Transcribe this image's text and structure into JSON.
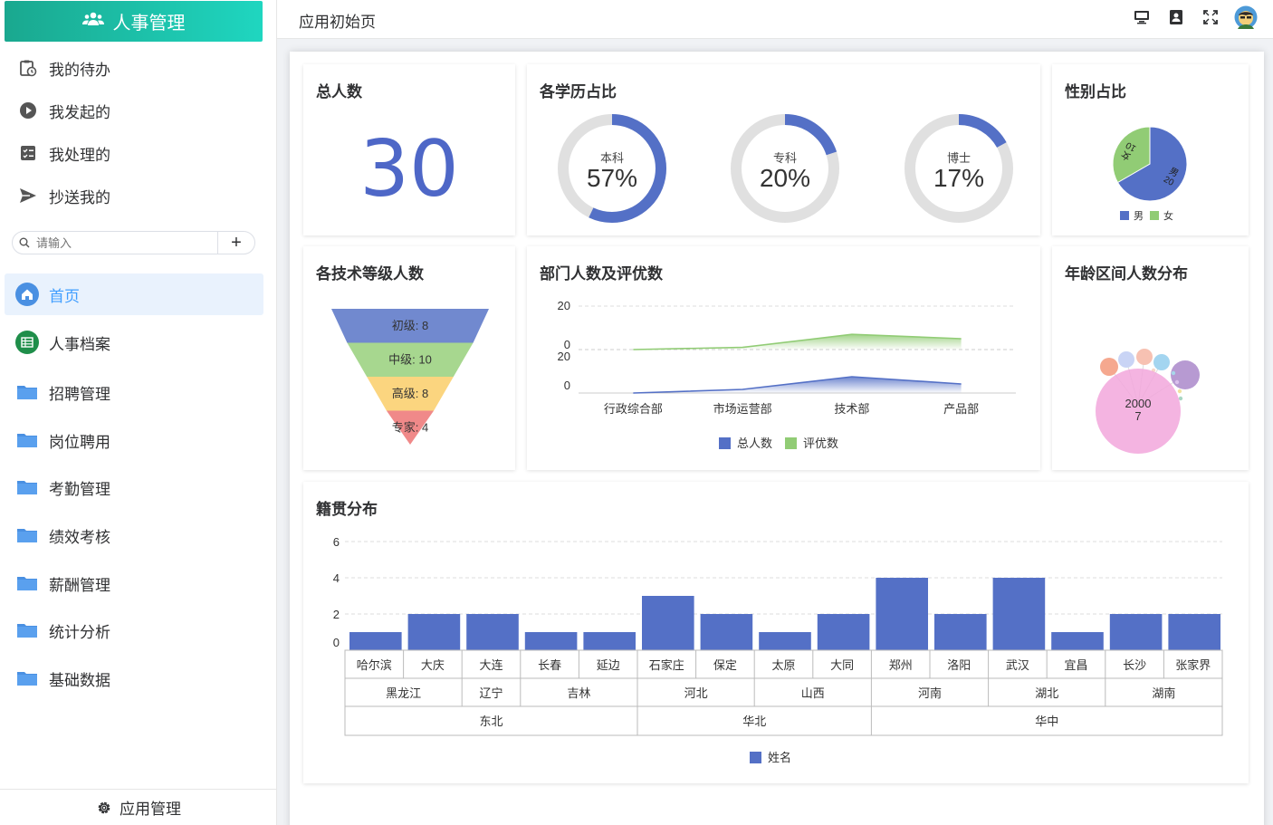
{
  "app": {
    "brand_title": "人事管理",
    "page_title": "应用初始页",
    "footer_label": "应用管理"
  },
  "sidebar": {
    "quick": [
      "我的待办",
      "我发起的",
      "我处理的",
      "抄送我的"
    ],
    "search_placeholder": "请输入",
    "home_label": "首页",
    "menu": [
      "人事档案",
      "招聘管理",
      "岗位聘用",
      "考勤管理",
      "绩效考核",
      "薪酬管理",
      "统计分析",
      "基础数据"
    ]
  },
  "colors": {
    "accent": "#5470c6",
    "green": "#91cc75",
    "yellow": "#fac858",
    "red": "#ee6666",
    "teal": "#1fc7b0"
  },
  "cards": {
    "total": {
      "title": "总人数",
      "value": "30"
    },
    "education": {
      "title": "各学历占比",
      "items": [
        {
          "label": "本科",
          "text": "57%",
          "value": 57
        },
        {
          "label": "专科",
          "text": "20%",
          "value": 20
        },
        {
          "label": "博士",
          "text": "17%",
          "value": 17
        }
      ]
    },
    "gender": {
      "title": "性别占比",
      "legend": [
        "男",
        "女"
      ]
    },
    "tech": {
      "title": "各技术等级人数"
    },
    "dept": {
      "title": "部门人数及评优数"
    },
    "age": {
      "title": "年龄区间人数分布"
    },
    "origin": {
      "title": "籍贯分布"
    }
  },
  "chart_data": [
    {
      "type": "pie",
      "title": "性别占比",
      "slices": [
        {
          "name": "男",
          "value": 20,
          "label_name": "男",
          "label_value": "20",
          "color": "#5470c6"
        },
        {
          "name": "女",
          "value": 10,
          "label_name": "女",
          "label_value": "10",
          "color": "#91cc75"
        }
      ],
      "legend": "bottom"
    },
    {
      "type": "funnel",
      "title": "各技术等级人数",
      "items": [
        {
          "name": "初级",
          "value": 8,
          "label": "初级: 8",
          "color": "#7189cf"
        },
        {
          "name": "中级",
          "value": 10,
          "label": "中级: 10",
          "color": "#a7d78f"
        },
        {
          "name": "高级",
          "value": 8,
          "label": "高级: 8",
          "color": "#fbd57f"
        },
        {
          "name": "专家",
          "value": 4,
          "label": "专家: 4",
          "color": "#f08989"
        }
      ]
    },
    {
      "type": "area",
      "title": "部门人数及评优数",
      "categories": [
        "行政综合部",
        "市场运营部",
        "技术部",
        "产品部"
      ],
      "series": [
        {
          "name": "总人数",
          "values": [
            0,
            2,
            9,
            5
          ],
          "color": "#5470c6"
        },
        {
          "name": "评优数",
          "values": [
            0,
            1,
            7,
            5
          ],
          "color": "#91cc75"
        }
      ],
      "ylim_top": [
        0,
        20
      ],
      "ylim_bottom": [
        0,
        20
      ],
      "y_ticks_top": [
        "20",
        "0"
      ],
      "y_ticks_bottom": [
        "20",
        "0"
      ],
      "legend": "bottom"
    },
    {
      "type": "bubble",
      "title": "年龄区间人数分布",
      "main": {
        "label": "2000",
        "value": "7"
      }
    },
    {
      "type": "bar",
      "title": "籍贯分布",
      "categories": [
        "哈尔滨",
        "大庆",
        "大连",
        "长春",
        "延边",
        "石家庄",
        "保定",
        "太原",
        "大同",
        "郑州",
        "洛阳",
        "武汉",
        "宜昌",
        "长沙",
        "张家界"
      ],
      "series": [
        {
          "name": "姓名",
          "values": [
            1,
            2,
            2,
            1,
            1,
            3,
            2,
            1,
            2,
            4,
            2,
            4,
            1,
            2,
            2
          ]
        }
      ],
      "y_ticks": [
        "6",
        "4",
        "2",
        "0"
      ],
      "ylim": [
        0,
        6
      ],
      "provinces": [
        {
          "name": "黑龙江",
          "span": 2
        },
        {
          "name": "辽宁",
          "span": 1
        },
        {
          "name": "吉林",
          "span": 2
        },
        {
          "name": "河北",
          "span": 2
        },
        {
          "name": "山西",
          "span": 2
        },
        {
          "name": "河南",
          "span": 2
        },
        {
          "name": "湖北",
          "span": 2
        },
        {
          "name": "湖南",
          "span": 2
        }
      ],
      "regions": [
        {
          "name": "东北",
          "span": 5
        },
        {
          "name": "华北",
          "span": 4
        },
        {
          "name": "华中",
          "span": 6
        }
      ],
      "legend": "bottom"
    }
  ]
}
